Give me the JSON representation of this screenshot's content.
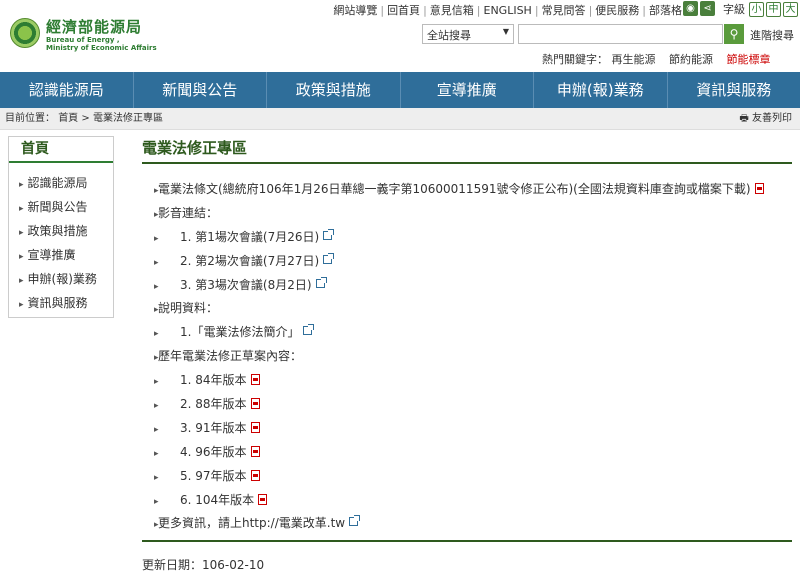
{
  "logo": {
    "name_cn": "經濟部能源局",
    "name_en_line1": "Bureau of Energy ,",
    "name_en_line2": "Ministry of Economic Affairs"
  },
  "top_links": [
    "網站導覽",
    "回首頁",
    "意見信箱",
    "ENGLISH",
    "常見問答",
    "便民服務",
    "部落格"
  ],
  "social_icons": [
    "rss-icon",
    "share-icon"
  ],
  "font_size": {
    "label": "字級",
    "options": [
      "小",
      "中",
      "大"
    ]
  },
  "search": {
    "scope": "全站搜尋",
    "button_icon": "search-icon",
    "advanced_label": "進階搜尋"
  },
  "hot_keywords": {
    "label": "熱門關鍵字：",
    "items": [
      "再生能源",
      "節約能源",
      "節能標章"
    ]
  },
  "main_nav": [
    "認識能源局",
    "新聞與公告",
    "政策與措施",
    "宣導推廣",
    "申辦(報)業務",
    "資訊與服務"
  ],
  "breadcrumb": {
    "prefix": "目前位置：",
    "home": "首頁",
    "separator": ">",
    "current": "電業法修正專區"
  },
  "print_label": "友善列印",
  "sidebar": {
    "title": "首頁",
    "items": [
      "認識能源局",
      "新聞與公告",
      "政策與措施",
      "宣導推廣",
      "申辦(報)業務",
      "資訊與服務"
    ]
  },
  "page_title": "電業法修正專區",
  "entries": [
    {
      "level": 0,
      "text": "電業法條文(總統府106年1月26日華總一義字第10600011591號令修正公布)(全國法規資料庫查詢或檔案下載)",
      "icon": "pdf"
    },
    {
      "level": 0,
      "text": "影音連結：",
      "icon": ""
    },
    {
      "level": 1,
      "text": "1. 第1場次會議(7月26日)",
      "icon": "ext"
    },
    {
      "level": 1,
      "text": "2. 第2場次會議(7月27日)",
      "icon": "ext"
    },
    {
      "level": 1,
      "text": "3. 第3場次會議(8月2日)",
      "icon": "ext"
    },
    {
      "level": 0,
      "text": "說明資料：",
      "icon": ""
    },
    {
      "level": 1,
      "text": "1.「電業法修法簡介」",
      "icon": "ext"
    },
    {
      "level": 0,
      "text": "歷年電業法修正草案內容：",
      "icon": ""
    },
    {
      "level": 1,
      "text": "1. 84年版本",
      "icon": "pdf"
    },
    {
      "level": 1,
      "text": "2. 88年版本",
      "icon": "pdf"
    },
    {
      "level": 1,
      "text": "3. 91年版本",
      "icon": "pdf"
    },
    {
      "level": 1,
      "text": "4. 96年版本",
      "icon": "pdf"
    },
    {
      "level": 1,
      "text": "5. 97年版本",
      "icon": "pdf"
    },
    {
      "level": 1,
      "text": "6. 104年版本",
      "icon": "pdf"
    },
    {
      "level": 0,
      "text": "更多資訊，請上http://電業改革.tw",
      "icon": "ext"
    }
  ],
  "updated": "更新日期：106-02-10",
  "colors": {
    "nav_bg": "#2f6e9a",
    "accent_green": "#2e5a1e",
    "hot_red": "#cc0000"
  }
}
